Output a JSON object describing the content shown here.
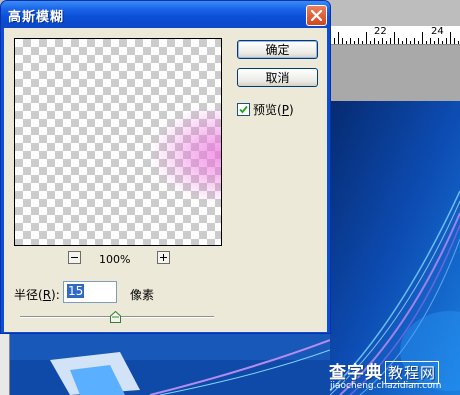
{
  "dialog": {
    "title": "高斯模糊",
    "ok_label": "确定",
    "cancel_label": "取消",
    "preview_label_pre": "预览(",
    "preview_label_key": "P",
    "preview_label_post": ")",
    "preview_checked": true,
    "zoom_level": "100%",
    "radius_label_pre": "半径(",
    "radius_label_key": "R",
    "radius_label_post": "):",
    "radius_value": "15",
    "pixels_label": "像素",
    "radius_slider_fraction": 0.49
  },
  "ruler": {
    "labels": [
      "22",
      "24"
    ]
  },
  "watermark": {
    "main_a": "查字典",
    "main_b": "教程网",
    "url": "jiaocheng.chazidian.com"
  },
  "icons": {
    "close": "close-icon",
    "zoom_out": "minus-icon",
    "zoom_in": "plus-icon",
    "checkbox": "checkmark-icon",
    "slider": "slider-thumb-icon"
  },
  "colors": {
    "titlebar": "#0a4fd6",
    "close_button": "#d2451d",
    "dialog_body": "#ece9d8",
    "preview_blur": "#eb6edc",
    "selection": "#316ac5"
  }
}
